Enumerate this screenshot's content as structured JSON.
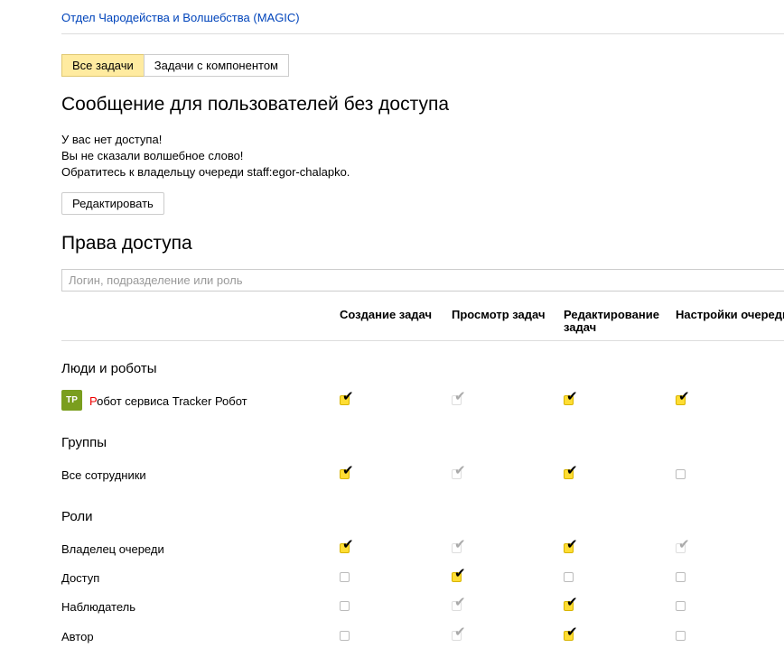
{
  "breadcrumb": "Отдел Чародейства и Волшебства (MAGIC)",
  "tabs": [
    {
      "label": "Все задачи",
      "active": true
    },
    {
      "label": "Задачи с компонентом",
      "active": false
    }
  ],
  "message_section": {
    "title": "Сообщение для пользователей без доступа",
    "lines": [
      "У вас нет доступа!",
      "Вы не сказали волшебное слово!",
      "Обратитесь к владельцу очереди staff:egor-chalapko."
    ],
    "edit_button": "Редактировать"
  },
  "access": {
    "title": "Права доступа",
    "search_placeholder": "Логин, подразделение или роль",
    "columns": [
      "Создание задач",
      "Просмотр задач",
      "Редактирование задач",
      "Настройки очереди"
    ],
    "sections": [
      {
        "title": "Люди и роботы",
        "rows": [
          {
            "name_first": "Р",
            "name_rest": "обот сервиса Tracker Робот",
            "avatar": "TP",
            "perms": [
              "on",
              "dis",
              "on",
              "on"
            ]
          }
        ]
      },
      {
        "title": "Группы",
        "rows": [
          {
            "name": "Все сотрудники",
            "perms": [
              "on",
              "dis",
              "on",
              "off"
            ]
          }
        ]
      },
      {
        "title": "Роли",
        "rows": [
          {
            "name": "Владелец очереди",
            "perms": [
              "on",
              "dis",
              "on",
              "dis"
            ]
          },
          {
            "name": "Доступ",
            "perms": [
              "off",
              "on",
              "off",
              "off"
            ]
          },
          {
            "name": "Наблюдатель",
            "perms": [
              "off",
              "dis",
              "on",
              "off"
            ]
          },
          {
            "name": "Автор",
            "perms": [
              "off",
              "dis",
              "on",
              "off"
            ]
          }
        ]
      }
    ]
  },
  "colors": {
    "link": "#0044bb",
    "active_tab": "#ffeba0",
    "checkbox_on": "#ffdd33",
    "avatar": "#7a9e1e"
  },
  "icons": {
    "check": "check-icon"
  }
}
